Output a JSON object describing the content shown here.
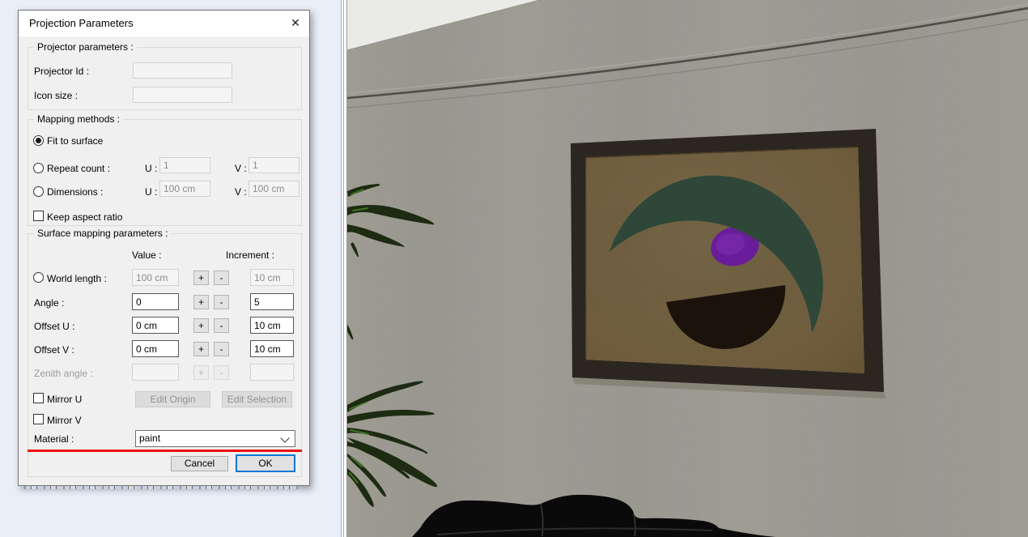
{
  "window": {
    "title": "Projection Parameters",
    "close_icon": "✕"
  },
  "projector_group": {
    "label": "Projector parameters :",
    "projector_id_label": "Projector Id :",
    "projector_id_value": "",
    "icon_size_label": "Icon size :",
    "icon_size_value": ""
  },
  "mapping_group": {
    "label": "Mapping methods :",
    "fit_to_surface_label": "Fit to surface",
    "repeat_count_label": "Repeat count :",
    "dimensions_label": "Dimensions :",
    "u_label": "U :",
    "v_label": "V :",
    "repeat_u_value": "1",
    "repeat_v_value": "1",
    "dimensions_u_value": "100 cm",
    "dimensions_v_value": "100 cm",
    "keep_aspect_ratio_label": "Keep aspect ratio"
  },
  "surface_group": {
    "label": "Surface mapping parameters :",
    "value_header": "Value :",
    "increment_header": "Increment :",
    "plus_label": "+",
    "minus_label": "-",
    "world_length": {
      "label": "World length :",
      "value": "100 cm",
      "increment": "10 cm"
    },
    "angle": {
      "label": "Angle :",
      "value": "0",
      "increment": "5"
    },
    "offset_u": {
      "label": "Offset U :",
      "value": "0 cm",
      "increment": "10 cm"
    },
    "offset_v": {
      "label": "Offset V :",
      "value": "0 cm",
      "increment": "10 cm"
    },
    "zenith_angle": {
      "label": "Zenith angle :",
      "value": "",
      "increment": ""
    },
    "mirror_u_label": "Mirror U",
    "mirror_v_label": "Mirror V",
    "edit_origin_label": "Edit Origin",
    "edit_selection_label": "Edit Selection",
    "material_label": "Material :",
    "material_value": "paint"
  },
  "footer": {
    "cancel_label": "Cancel",
    "ok_label": "OK"
  },
  "colors": {
    "accent_blue": "#0078d7",
    "highlight_red": "#ee1111"
  },
  "scene_colors": {
    "wall": "#dcd9cd",
    "ceiling": "#eaeae7",
    "trim": "#4d4d46",
    "trim_light": "#84837b",
    "frame": "#2b2620",
    "canvas": "#e2bd7b",
    "arc": "#2e4739",
    "ellipse": "#6a1d9a",
    "half_disc": "#1b120c",
    "plant": "#1c2b11",
    "plant_highlight": "#4c8527",
    "couch": "#0f0e0d"
  }
}
